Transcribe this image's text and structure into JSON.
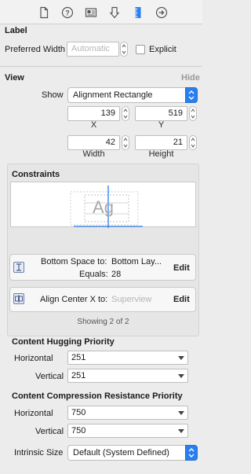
{
  "toolbar": {
    "icons": [
      "file-icon",
      "help-icon",
      "identity-icon",
      "attributes-icon",
      "size-ruler-icon",
      "connections-arrow-icon"
    ],
    "selected": "size-ruler-icon",
    "accent": "#2a7ff0"
  },
  "label_section": {
    "title": "Label",
    "preferred_width_label": "Preferred Width",
    "preferred_width_placeholder": "Automatic",
    "explicit_label": "Explicit",
    "explicit_checked": false
  },
  "view_section": {
    "title": "View",
    "hide_label": "Hide",
    "show_label": "Show",
    "show_value": "Alignment Rectangle",
    "x_value": "139",
    "y_value": "519",
    "x_caption": "X",
    "y_caption": "Y",
    "width_value": "42",
    "height_value": "21",
    "width_caption": "Width",
    "height_caption": "Height"
  },
  "constraints": {
    "title": "Constraints",
    "preview_text": "Ag",
    "items": [
      {
        "line1_name": "Bottom Space to:",
        "line1_target": "Bottom Lay...",
        "line2_name": "Equals:",
        "line2_value": "28",
        "edit": "Edit",
        "icon": "vertical-space-constraint-icon"
      },
      {
        "line1_name": "Align Center X to:",
        "line1_target": "Superview",
        "edit": "Edit",
        "icon": "center-x-constraint-icon"
      }
    ],
    "showing": "Showing 2 of 2"
  },
  "hugging": {
    "title": "Content Hugging Priority",
    "horizontal_label": "Horizontal",
    "horizontal_value": "251",
    "vertical_label": "Vertical",
    "vertical_value": "251"
  },
  "compression": {
    "title": "Content Compression Resistance Priority",
    "horizontal_label": "Horizontal",
    "horizontal_value": "750",
    "vertical_label": "Vertical",
    "vertical_value": "750"
  },
  "intrinsic": {
    "label": "Intrinsic Size",
    "value": "Default (System Defined)"
  }
}
